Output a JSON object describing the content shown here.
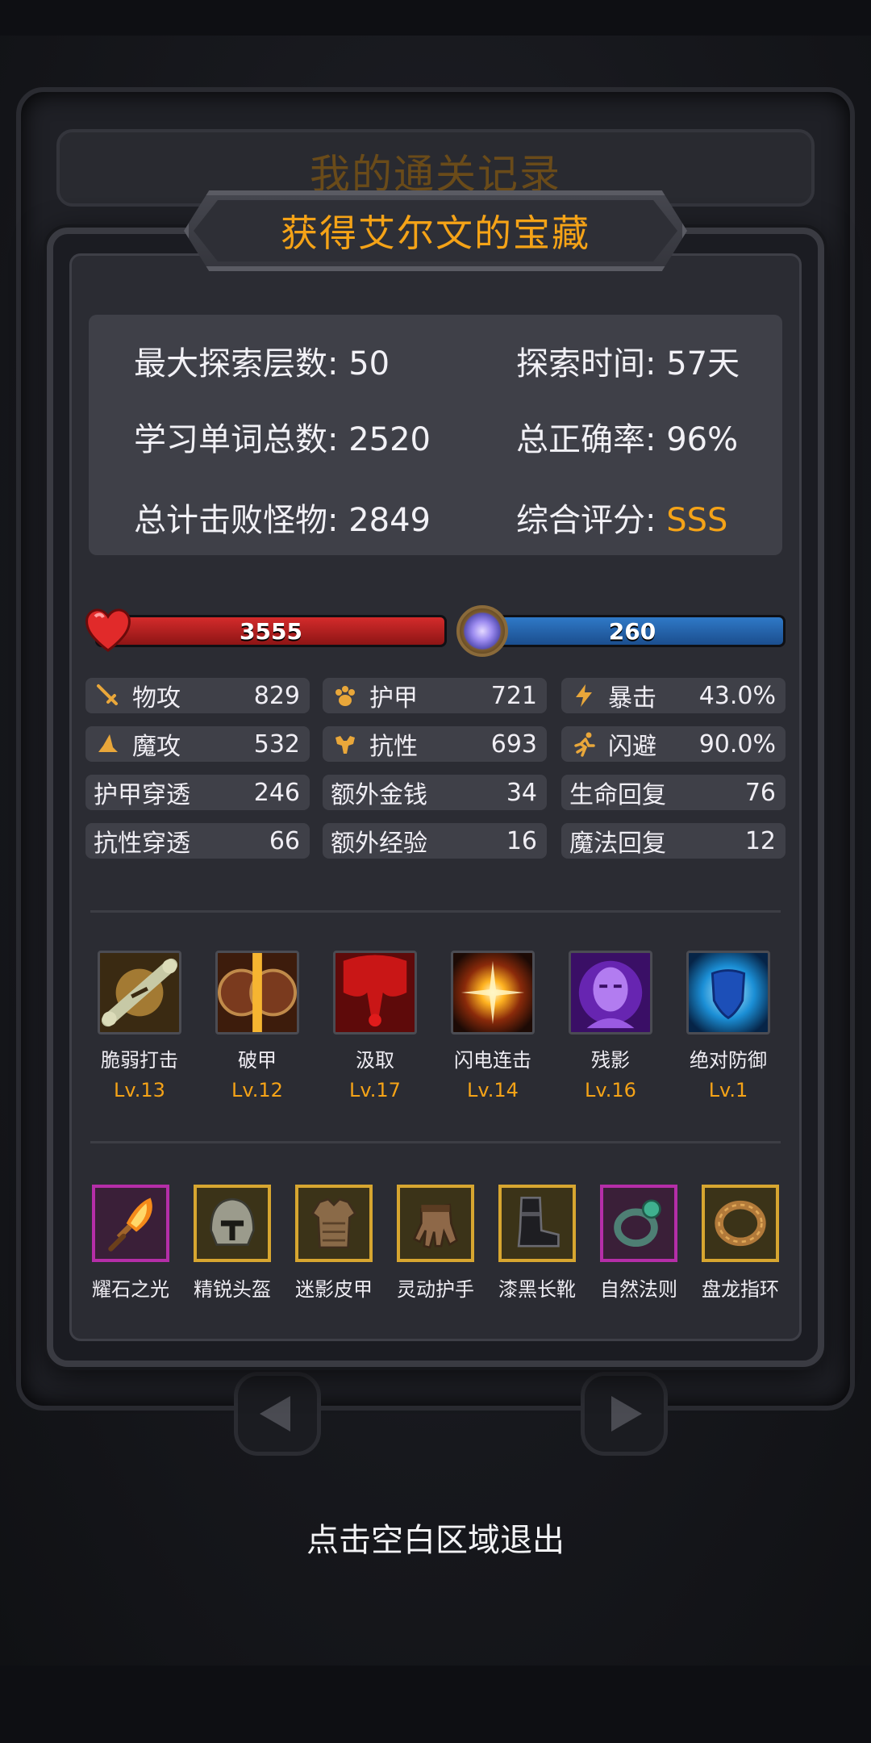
{
  "background": {
    "title": "我的通关记录"
  },
  "dialog": {
    "title": "获得艾尔文的宝藏"
  },
  "summary": [
    {
      "label": "最大探索层数:",
      "value": "50"
    },
    {
      "label": "探索时间:",
      "value": "57天"
    },
    {
      "label": "学习单词总数:",
      "value": "2520"
    },
    {
      "label": "总正确率:",
      "value": "96%"
    },
    {
      "label": "总计击败怪物:",
      "value": "2849"
    },
    {
      "label": "综合评分:",
      "value": "SSS"
    }
  ],
  "bars": {
    "hp": "3555",
    "mp": "260"
  },
  "stats": [
    {
      "icon": "sword-icon",
      "label": "物攻",
      "value": "829"
    },
    {
      "icon": "paw-icon",
      "label": "护甲",
      "value": "721"
    },
    {
      "icon": "lightning-icon",
      "label": "暴击",
      "value": "43.0%"
    },
    {
      "icon": "wizard-hat-icon",
      "label": "魔攻",
      "value": "532"
    },
    {
      "icon": "muscle-icon",
      "label": "抗性",
      "value": "693"
    },
    {
      "icon": "running-icon",
      "label": "闪避",
      "value": "90.0%"
    },
    {
      "label": "护甲穿透",
      "value": "246"
    },
    {
      "label": "额外金钱",
      "value": "34"
    },
    {
      "label": "生命回复",
      "value": "76"
    },
    {
      "label": "抗性穿透",
      "value": "66"
    },
    {
      "label": "额外经验",
      "value": "16"
    },
    {
      "label": "魔法回复",
      "value": "12"
    }
  ],
  "skills": [
    {
      "icon": "bone-break-icon",
      "name": "脆弱打击",
      "level": "Lv.13"
    },
    {
      "icon": "shield-split-icon",
      "name": "破甲",
      "level": "Lv.12"
    },
    {
      "icon": "blood-drain-icon",
      "name": "汲取",
      "level": "Lv.17"
    },
    {
      "icon": "lightning-burst-icon",
      "name": "闪电连击",
      "level": "Lv.14"
    },
    {
      "icon": "shadow-face-icon",
      "name": "残影",
      "level": "Lv.16"
    },
    {
      "icon": "blue-shield-icon",
      "name": "绝对防御",
      "level": "Lv.1"
    }
  ],
  "equipment": [
    {
      "icon": "flame-dagger-icon",
      "name": "耀石之光",
      "rarity": "epic"
    },
    {
      "icon": "helmet-icon",
      "name": "精锐头盔",
      "rarity": "legendary"
    },
    {
      "icon": "leather-armor-icon",
      "name": "迷影皮甲",
      "rarity": "legendary"
    },
    {
      "icon": "gauntlet-icon",
      "name": "灵动护手",
      "rarity": "legendary"
    },
    {
      "icon": "black-boots-icon",
      "name": "漆黑长靴",
      "rarity": "legendary"
    },
    {
      "icon": "gem-ring-icon",
      "name": "自然法则",
      "rarity": "epic"
    },
    {
      "icon": "dragon-ring-icon",
      "name": "盘龙指环",
      "rarity": "legendary"
    }
  ],
  "footer": {
    "hint": "点击空白区域退出"
  },
  "colors": {
    "accent": "#f5a317",
    "hp": "#c62323",
    "mp": "#2566b0",
    "epic_border": "#b52ea8",
    "legendary_border": "#d7a630"
  }
}
